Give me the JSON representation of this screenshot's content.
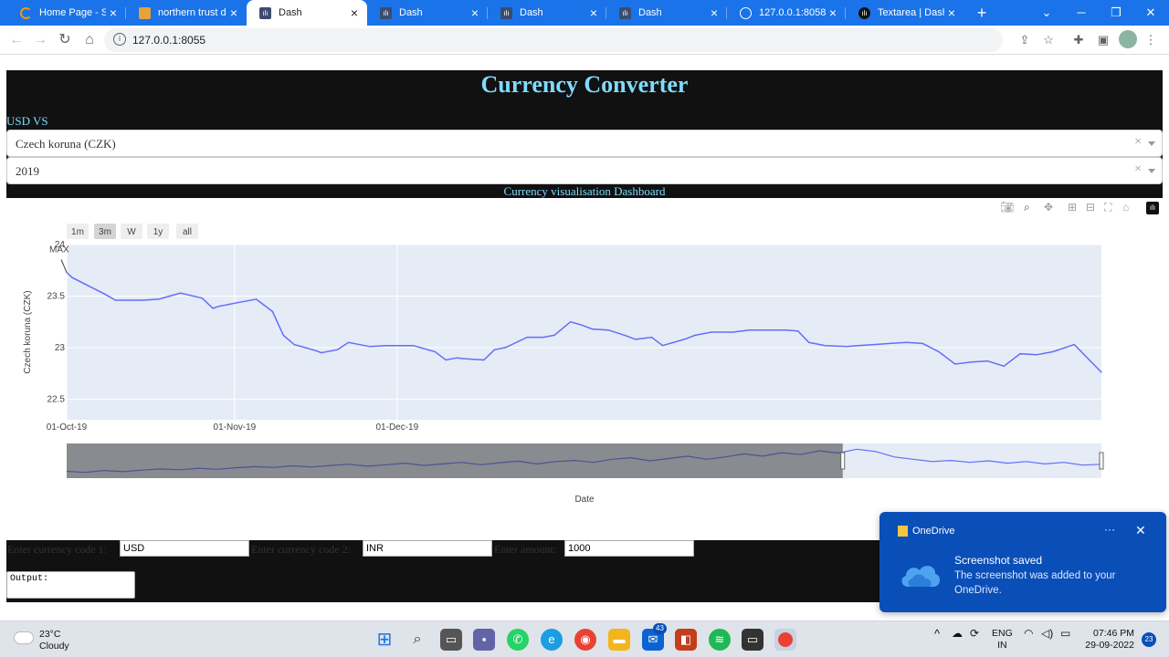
{
  "browser": {
    "tabs": [
      {
        "title": "Home Page - Sele",
        "active": false,
        "favicon": "spinner-icon"
      },
      {
        "title": "northern trust da",
        "active": false,
        "favicon": "doc-icon"
      },
      {
        "title": "Dash",
        "active": true,
        "favicon": "dash-icon"
      },
      {
        "title": "Dash",
        "active": false,
        "favicon": "dash-icon"
      },
      {
        "title": "Dash",
        "active": false,
        "favicon": "dash-icon"
      },
      {
        "title": "Dash",
        "active": false,
        "favicon": "dash-icon"
      },
      {
        "title": "127.0.0.1:8058",
        "active": false,
        "favicon": "globe-icon"
      },
      {
        "title": "Textarea | Dash fo",
        "active": false,
        "favicon": "dash-dark-icon"
      }
    ],
    "url": "127.0.0.1:8055"
  },
  "app": {
    "title": "Currency Converter",
    "base_label": "USD VS",
    "currency_dropdown": "Czech koruna (CZK)",
    "year_dropdown": "2019",
    "dashboard_title": "Currency visualisation Dashboard"
  },
  "chart_data": {
    "type": "line",
    "range_buttons": [
      "1m",
      "3m",
      "W",
      "1y",
      "all"
    ],
    "active_range_button": "3m",
    "ylabel": "Czech koruna  (CZK)",
    "xlabel": "Date",
    "x_ticks": [
      "01-Oct-19",
      "01-Nov-19",
      "01-Dec-19"
    ],
    "y_ticks": [
      "22.5",
      "23",
      "23.5",
      "24"
    ],
    "ylim": [
      22.3,
      24.0
    ],
    "annotation": "MAX",
    "line_color": "#636efa",
    "plot_bg": "#e5ecf6",
    "x_days": [
      0,
      1,
      4,
      7,
      9,
      14,
      17,
      19,
      21,
      25,
      27,
      28,
      30,
      32,
      35,
      38,
      40,
      42,
      44,
      46,
      47,
      50,
      52,
      56,
      59,
      62,
      64,
      68,
      70,
      72,
      74,
      77,
      79,
      81,
      85,
      88,
      90,
      93,
      95,
      97,
      100,
      103,
      105,
      108,
      110,
      114,
      116,
      119,
      123,
      126,
      128,
      130,
      133,
      135,
      137,
      140,
      144,
      146,
      149,
      152,
      155,
      158,
      161,
      164,
      167,
      170,
      173,
      176,
      179,
      182,
      186,
      191
    ],
    "values": [
      23.73,
      23.68,
      23.6,
      23.52,
      23.46,
      23.46,
      23.47,
      23.5,
      23.53,
      23.48,
      23.38,
      23.4,
      23.42,
      23.44,
      23.47,
      23.35,
      23.12,
      23.03,
      23.0,
      22.97,
      22.95,
      22.98,
      23.05,
      23.01,
      23.02,
      23.02,
      23.02,
      22.96,
      22.88,
      22.9,
      22.89,
      22.88,
      22.98,
      23.0,
      23.1,
      23.1,
      23.12,
      23.25,
      23.22,
      23.18,
      23.17,
      23.12,
      23.08,
      23.1,
      23.02,
      23.08,
      23.12,
      23.15,
      23.15,
      23.17,
      23.17,
      23.17,
      23.17,
      23.16,
      23.05,
      23.02,
      23.01,
      23.02,
      23.03,
      23.04,
      23.05,
      23.04,
      22.96,
      22.84,
      22.86,
      22.87,
      22.82,
      22.94,
      22.93,
      22.96,
      23.03,
      22.76
    ],
    "rangeslider_values": [
      22.87,
      22.84,
      22.89,
      22.86,
      22.9,
      22.93,
      22.91,
      22.95,
      22.92,
      22.96,
      22.99,
      22.97,
      23.01,
      22.98,
      23.02,
      23.05,
      23.0,
      23.04,
      23.08,
      23.02,
      23.06,
      23.1,
      23.04,
      23.09,
      23.13,
      23.06,
      23.12,
      23.15,
      23.1,
      23.18,
      23.22,
      23.14,
      23.2,
      23.26,
      23.18,
      23.24,
      23.32,
      23.26,
      23.35,
      23.3,
      23.4,
      23.34,
      23.44,
      23.38,
      23.24,
      23.18,
      23.12,
      23.15,
      23.1,
      23.14,
      23.08,
      23.12,
      23.06,
      23.1,
      23.03,
      23.05
    ],
    "rangeslider_selected_fraction": [
      0.0,
      0.75
    ]
  },
  "form": {
    "code1_label": "Enter currency code 1:",
    "code1_value": "USD",
    "code2_label": "Enter currency code 2:",
    "code2_value": "INR",
    "amount_label": "Enter amount:",
    "amount_value": "1000",
    "output_text": "Output:"
  },
  "toast": {
    "app": "OneDrive",
    "heading": "Screenshot saved",
    "body": "The screenshot was added to your OneDrive."
  },
  "taskbar": {
    "temperature": "23°C",
    "condition": "Cloudy",
    "mail_badge": "43",
    "lang1": "ENG",
    "lang2": "IN",
    "time": "07:46 PM",
    "date": "29-09-2022",
    "notifications": "23"
  }
}
